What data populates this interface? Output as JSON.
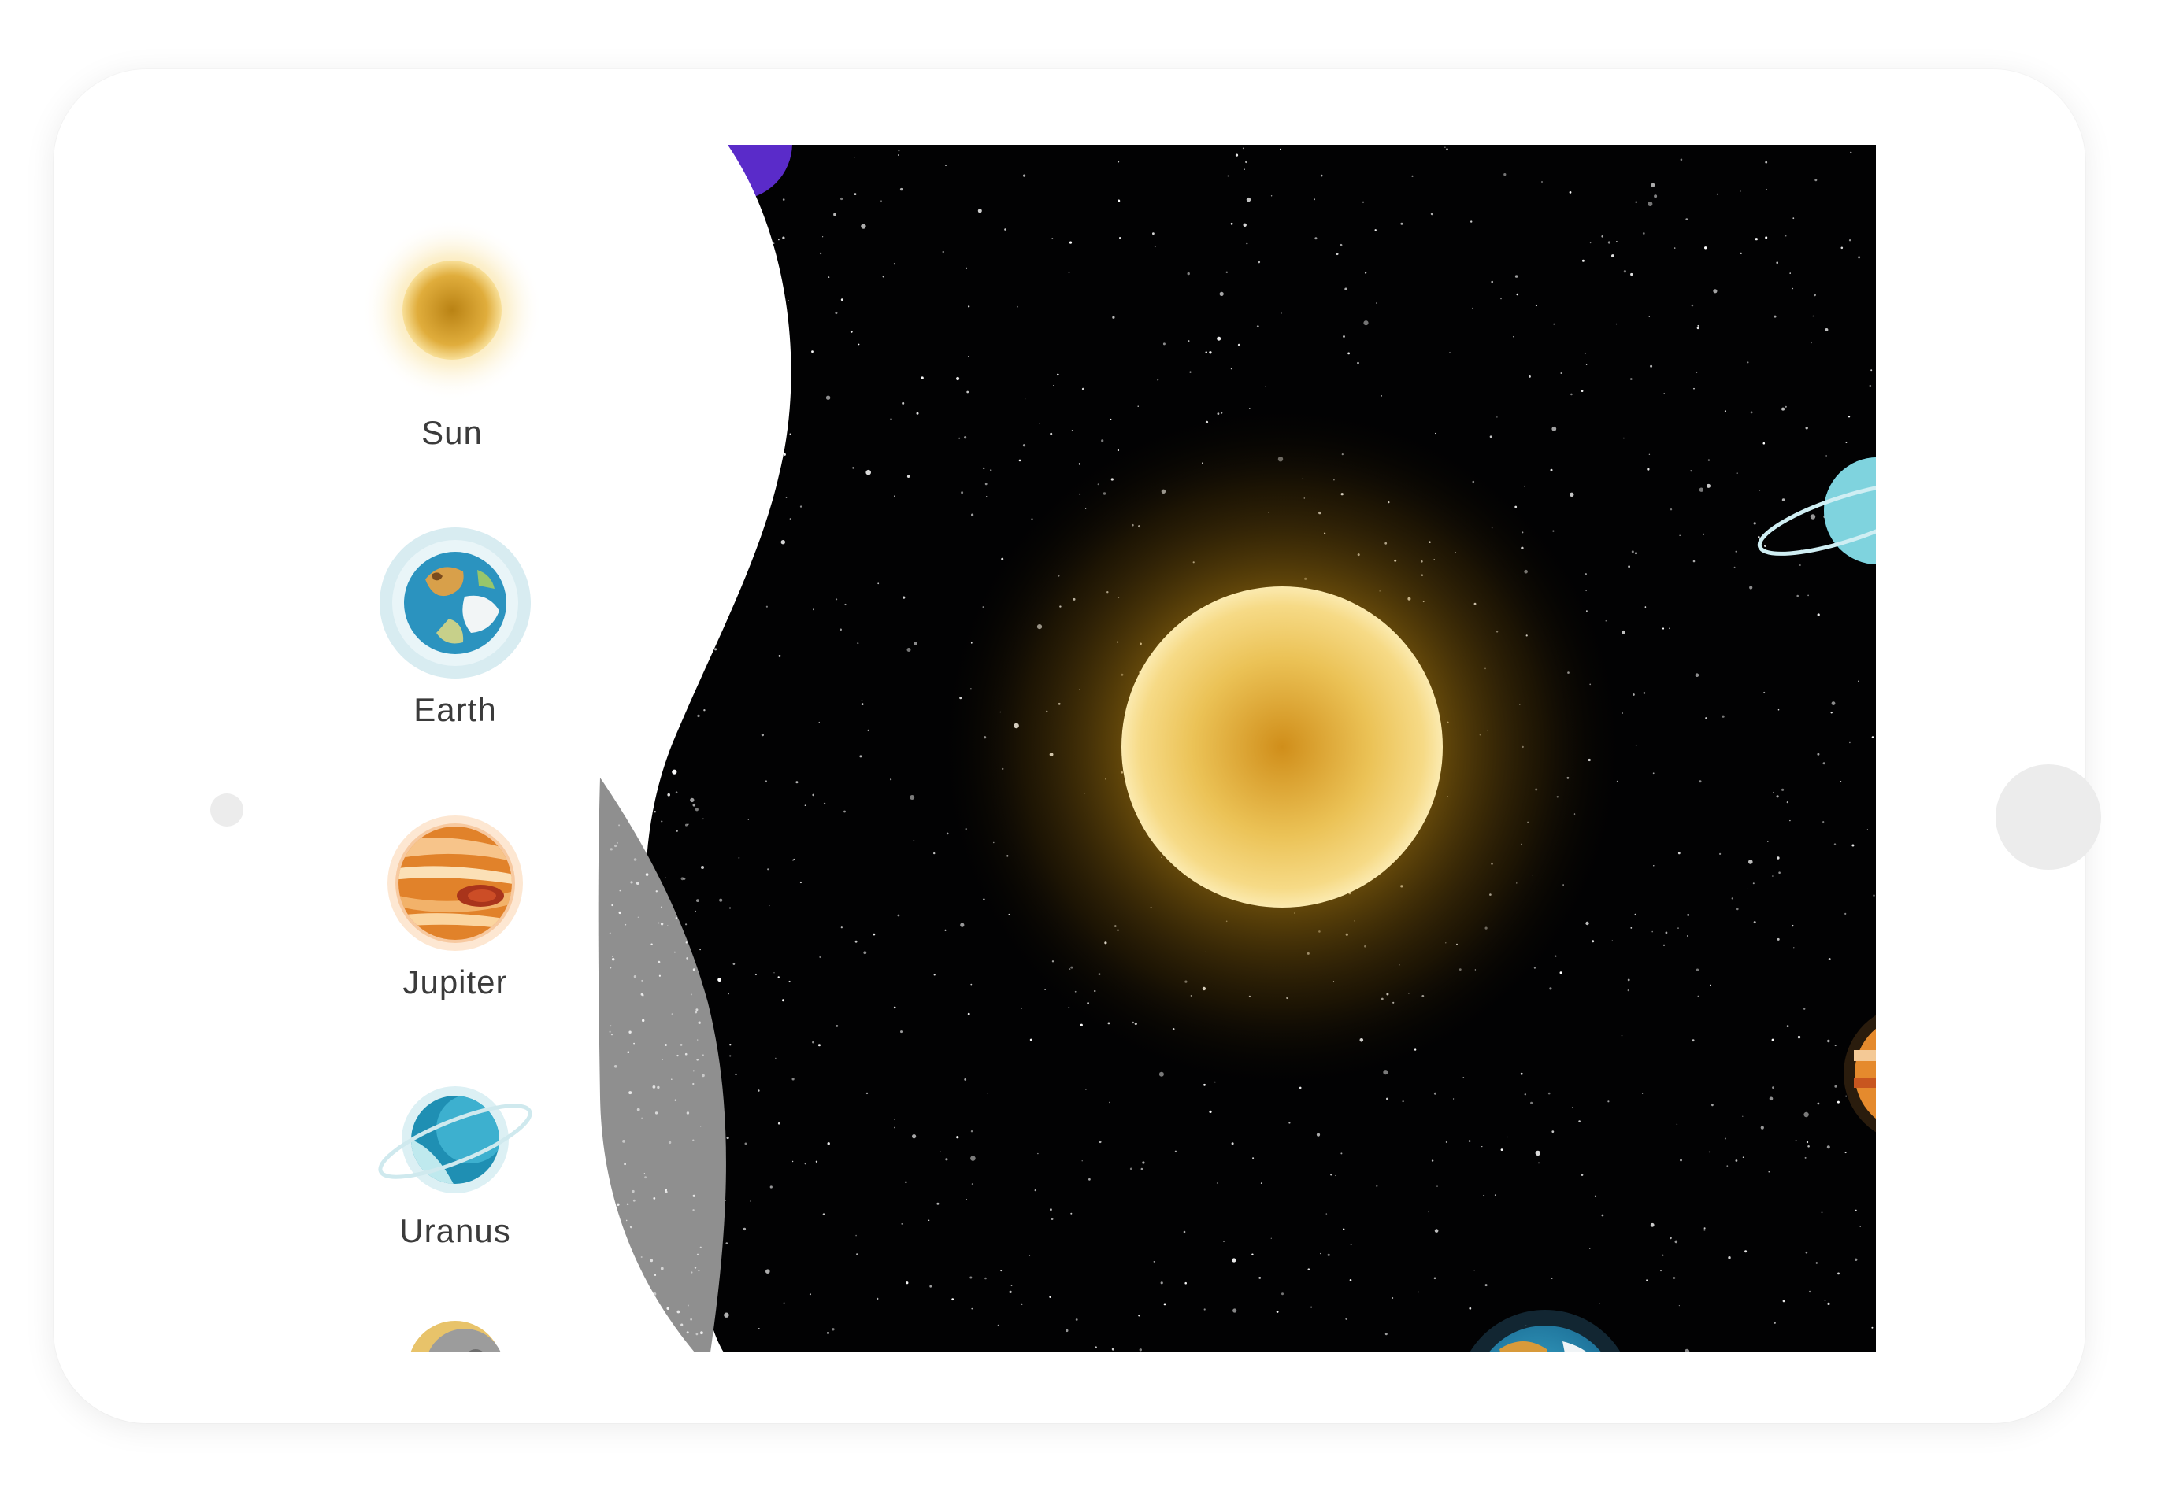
{
  "sidebar": {
    "items": [
      {
        "label": "Sun",
        "icon": "sun-icon"
      },
      {
        "label": "Earth",
        "icon": "earth-icon"
      },
      {
        "label": "Jupiter",
        "icon": "jupiter-icon"
      },
      {
        "label": "Uranus",
        "icon": "uranus-icon"
      },
      {
        "label": "",
        "icon": "mercury-icon"
      }
    ]
  },
  "scene": {
    "focused_body": "sun-icon",
    "colors": {
      "sun_core": "#d49a22",
      "sun_edge": "#f6dd94",
      "space": "#000000"
    }
  }
}
